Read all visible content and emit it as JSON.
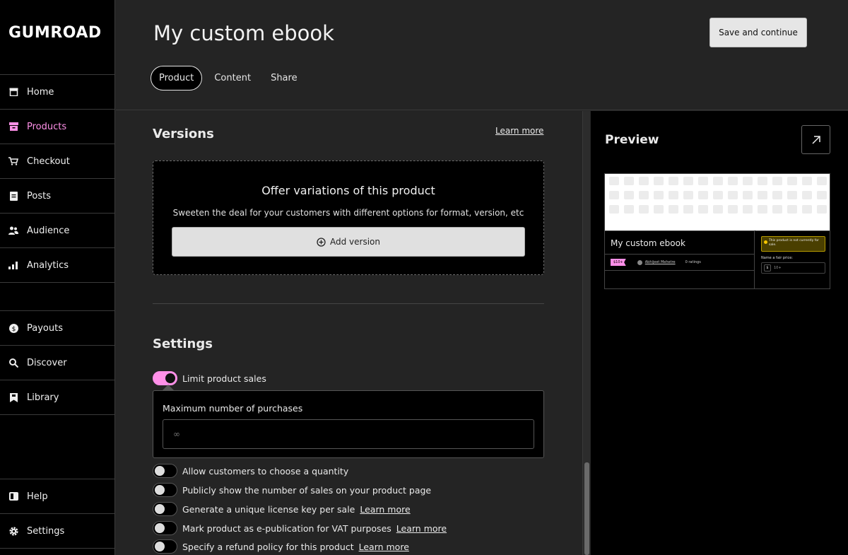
{
  "brand": {
    "logo_text": "GUMROAD",
    "accent_color": "#ff90e8"
  },
  "sidebar": {
    "items": [
      {
        "label": "Home",
        "icon": "store-icon"
      },
      {
        "label": "Products",
        "icon": "archive-icon",
        "active": true
      },
      {
        "label": "Checkout",
        "icon": "cart-icon"
      },
      {
        "label": "Posts",
        "icon": "document-icon"
      },
      {
        "label": "Audience",
        "icon": "people-icon"
      },
      {
        "label": "Analytics",
        "icon": "bar-chart-icon"
      },
      {
        "label": "Payouts",
        "icon": "dollar-icon"
      },
      {
        "label": "Discover",
        "icon": "search-icon"
      },
      {
        "label": "Library",
        "icon": "bookmark-icon"
      },
      {
        "label": "Help",
        "icon": "book-icon"
      },
      {
        "label": "Settings",
        "icon": "gear-icon"
      }
    ]
  },
  "header": {
    "title": "My custom ebook",
    "save_label": "Save and continue",
    "tabs": [
      {
        "label": "Product",
        "active": true
      },
      {
        "label": "Content"
      },
      {
        "label": "Share"
      }
    ]
  },
  "versions": {
    "title": "Versions",
    "learn_more": "Learn more",
    "empty_title": "Offer variations of this product",
    "empty_subtitle": "Sweeten the deal for your customers with different options for format, version, etc",
    "add_label": "Add version"
  },
  "settings": {
    "title": "Settings",
    "limit_sales": {
      "label": "Limit product sales",
      "on": true
    },
    "max_purchases": {
      "label": "Maximum number of purchases",
      "placeholder": "∞"
    },
    "toggles": [
      {
        "label": "Allow customers to choose a quantity",
        "on": false
      },
      {
        "label": "Publicly show the number of sales on your product page",
        "on": false
      },
      {
        "label": "Generate a unique license key per sale",
        "on": false,
        "link": "Learn more"
      },
      {
        "label": "Mark product as e-publication for VAT purposes",
        "on": false,
        "link": "Learn more"
      },
      {
        "label": "Specify a refund policy for this product",
        "on": false,
        "link": "Learn more"
      }
    ]
  },
  "preview": {
    "title": "Preview",
    "product_name": "My custom ebook",
    "price_tag": "$10+",
    "author": "Abhijeet Mehetre",
    "ratings": "0 ratings",
    "notice": "This product is not currently for sale.",
    "fair_price_label": "Name a fair price:",
    "currency": "$",
    "price_placeholder": "10+"
  }
}
